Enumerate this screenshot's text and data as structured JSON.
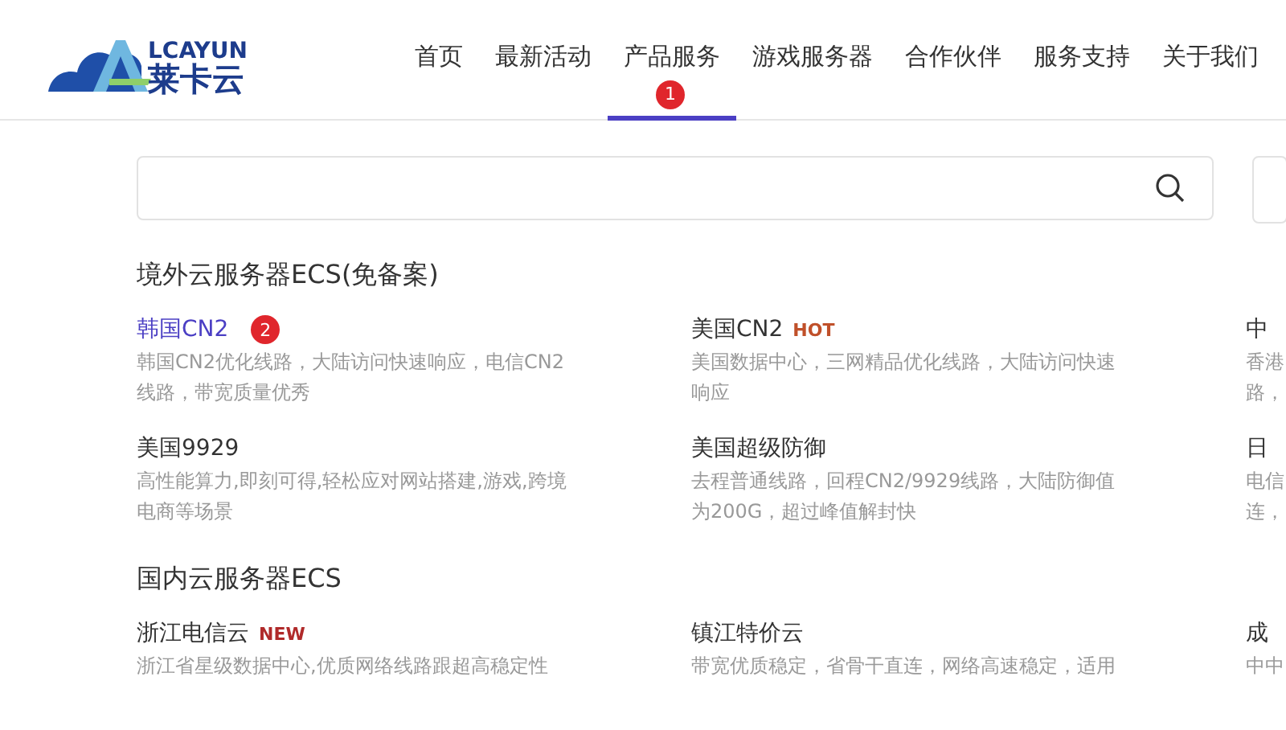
{
  "logo": {
    "latin": "LCAYUN",
    "chinese": "莱卡云"
  },
  "nav": [
    {
      "label": "首页",
      "selected": false
    },
    {
      "label": "最新活动",
      "selected": false
    },
    {
      "label": "产品服务",
      "selected": true,
      "badge": "1"
    },
    {
      "label": "游戏服务器",
      "selected": false
    },
    {
      "label": "合作伙伴",
      "selected": false
    },
    {
      "label": "服务支持",
      "selected": false
    },
    {
      "label": "关于我们",
      "selected": false
    }
  ],
  "sections": [
    {
      "title": "境外云服务器ECS(免备案)",
      "items": [
        {
          "title": "韩国CN2",
          "selected": true,
          "badge": "2",
          "desc": [
            "韩国CN2优化线路，大陆访问快速响应，电信CN2",
            "线路，带宽质量优秀"
          ]
        },
        {
          "title": "美国CN2",
          "tag": "HOT",
          "selected": false,
          "desc": [
            "美国数据中心，三网精品优化线路，大陆访问快速",
            "响应"
          ]
        },
        {
          "title": "中",
          "selected": false,
          "desc": [
            "香港",
            "路，"
          ]
        },
        {
          "title": "美国9929",
          "selected": false,
          "desc": [
            "高性能算力,即刻可得,轻松应对网站搭建,游戏,跨境",
            "电商等场景"
          ]
        },
        {
          "title": "美国超级防御",
          "selected": false,
          "desc": [
            "去程普通线路，回程CN2/9929线路，大陆防御值",
            "为200G，超过峰值解封快"
          ]
        },
        {
          "title": "日",
          "selected": false,
          "desc": [
            "电信",
            "连，"
          ]
        }
      ]
    },
    {
      "title": "国内云服务器ECS",
      "items": [
        {
          "title": "浙江电信云",
          "tag": "NEW",
          "selected": false,
          "desc": [
            "浙江省星级数据中心,优质网络线路跟超高稳定性"
          ]
        },
        {
          "title": "镇江特价云",
          "selected": false,
          "desc": [
            "带宽优质稳定，省骨干直连，网络高速稳定，适用"
          ]
        },
        {
          "title": "成",
          "selected": false,
          "desc": [
            "中中"
          ]
        }
      ]
    }
  ]
}
